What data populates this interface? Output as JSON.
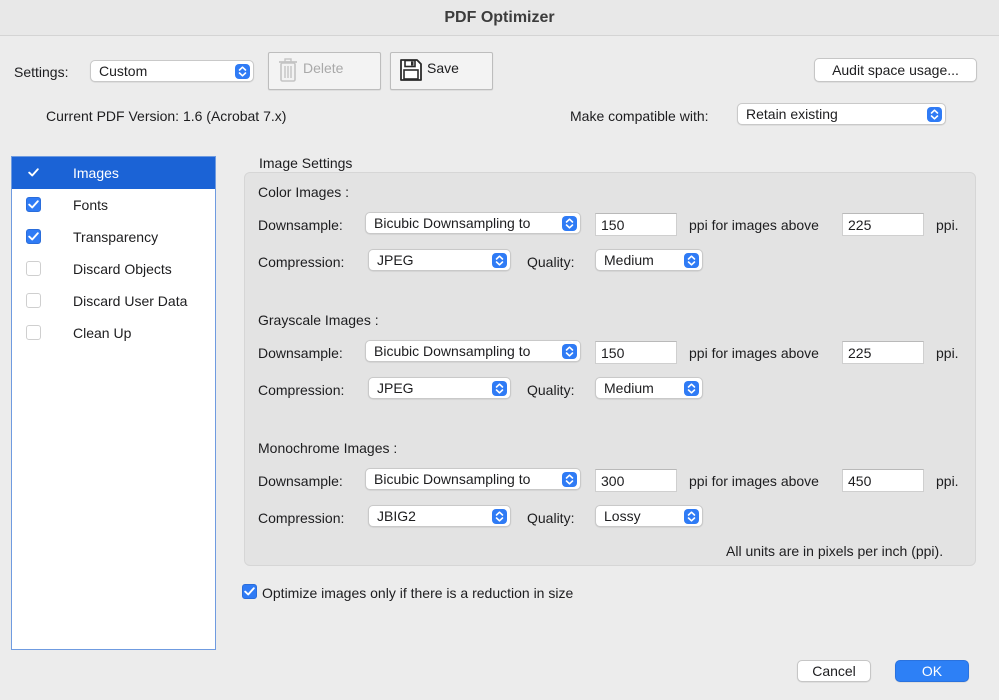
{
  "window": {
    "title": "PDF Optimizer"
  },
  "settings": {
    "label": "Settings:",
    "value": "Custom",
    "delete_label": "Delete",
    "save_label": "Save",
    "audit_label": "Audit space usage..."
  },
  "version": {
    "current": "Current PDF Version: 1.6 (Acrobat 7.x)",
    "compat_label": "Make compatible with:",
    "compat_value": "Retain existing"
  },
  "sidebar": {
    "items": [
      {
        "label": "Images",
        "checked": true,
        "selected": true
      },
      {
        "label": "Fonts",
        "checked": true,
        "selected": false
      },
      {
        "label": "Transparency",
        "checked": true,
        "selected": false
      },
      {
        "label": "Discard Objects",
        "checked": false,
        "selected": false
      },
      {
        "label": "Discard User Data",
        "checked": false,
        "selected": false
      },
      {
        "label": "Clean Up",
        "checked": false,
        "selected": false
      }
    ]
  },
  "image_settings": {
    "heading": "Image Settings",
    "downsample_label": "Downsample:",
    "compression_label": "Compression:",
    "quality_label": "Quality:",
    "ppi_above_label": "ppi for images above",
    "ppi_label": "ppi.",
    "color": {
      "heading": "Color Images :",
      "downsample": "Bicubic Downsampling to",
      "ppi": "150",
      "above": "225",
      "compression": "JPEG",
      "quality": "Medium"
    },
    "grayscale": {
      "heading": "Grayscale Images :",
      "downsample": "Bicubic Downsampling to",
      "ppi": "150",
      "above": "225",
      "compression": "JPEG",
      "quality": "Medium"
    },
    "monochrome": {
      "heading": "Monochrome Images :",
      "downsample": "Bicubic Downsampling to",
      "ppi": "300",
      "above": "450",
      "compression": "JBIG2",
      "quality": "Lossy"
    },
    "units_note": "All units are in pixels per inch (ppi)."
  },
  "optimize_only": {
    "label": "Optimize images only if there is a reduction in size",
    "checked": true
  },
  "footer": {
    "cancel_label": "Cancel",
    "ok_label": "OK"
  },
  "icons": {
    "popup": "chevron-updown-icon",
    "delete": "trash-icon",
    "save": "floppy-disk-icon",
    "check": "checkmark-icon"
  },
  "colors": {
    "accent": "#2f7bf5",
    "selection": "#1b63d6",
    "window_bg": "#ececec",
    "group_bg": "#e3e3e3"
  }
}
